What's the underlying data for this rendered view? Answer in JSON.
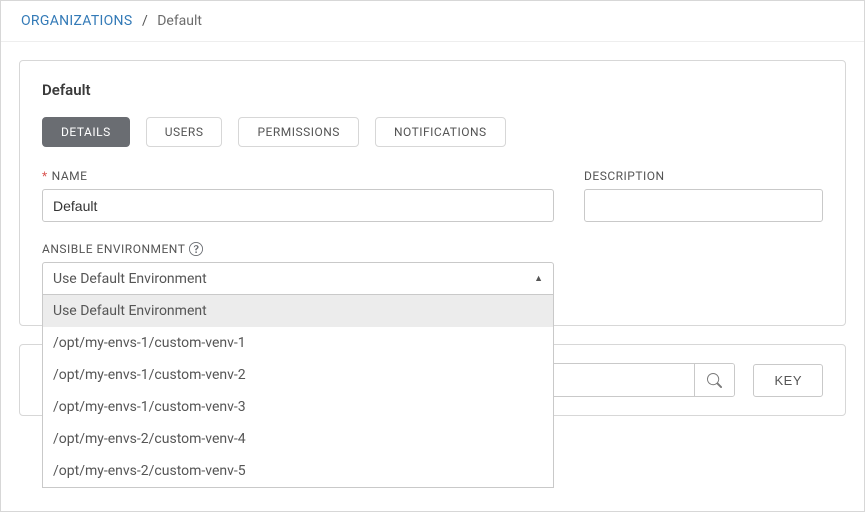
{
  "breadcrumb": {
    "root": "ORGANIZATIONS",
    "sep": "/",
    "current": "Default"
  },
  "panel": {
    "title": "Default"
  },
  "tabs": {
    "details": "DETAILS",
    "users": "USERS",
    "permissions": "PERMISSIONS",
    "notifications": "NOTIFICATIONS"
  },
  "form": {
    "name_required": "*",
    "name_label": "NAME",
    "name_value": "Default",
    "description_label": "DESCRIPTION",
    "description_value": "",
    "env_label": "ANSIBLE ENVIRONMENT",
    "env_selected": "Use Default Environment",
    "env_options": [
      "Use Default Environment",
      "/opt/my-envs-1/custom-venv-1",
      "/opt/my-envs-1/custom-venv-2",
      "/opt/my-envs-1/custom-venv-3",
      "/opt/my-envs-2/custom-venv-4",
      "/opt/my-envs-2/custom-venv-5"
    ]
  },
  "actions": {
    "key_button": "KEY"
  }
}
